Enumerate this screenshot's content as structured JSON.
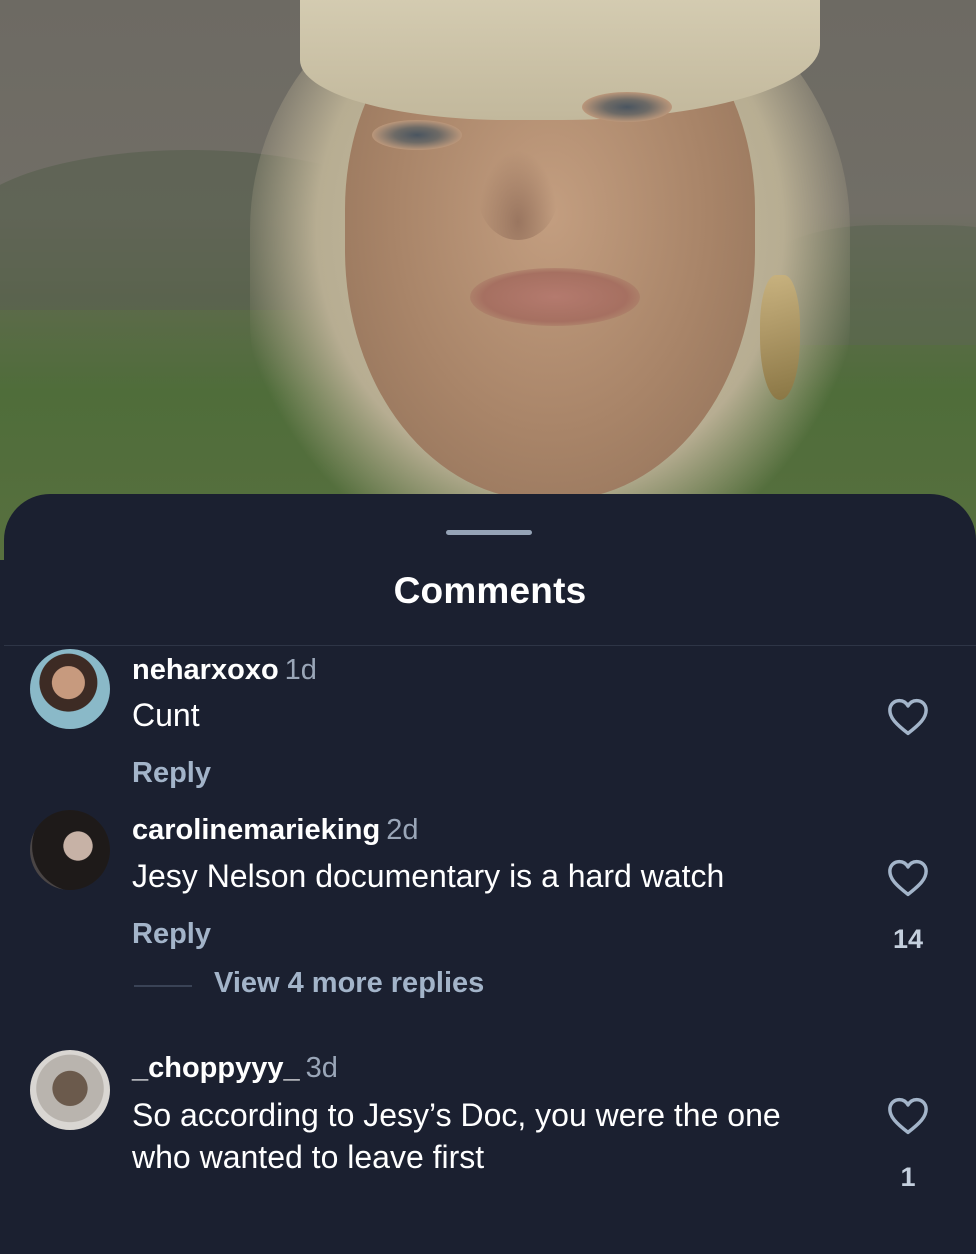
{
  "sheet": {
    "title": "Comments"
  },
  "comments": [
    {
      "username": "neharxoxo",
      "time": "1d",
      "text": "Cunt",
      "reply_label": "Reply",
      "likes": ""
    },
    {
      "username": "carolinemarieking",
      "time": "2d",
      "text": "Jesy Nelson documentary is a hard watch",
      "reply_label": "Reply",
      "likes": "14",
      "view_replies_label": "View 4 more replies"
    },
    {
      "username": "_choppyyy_",
      "time": "3d",
      "text": "So according to Jesy’s Doc, you were the one who wanted to leave first",
      "likes": "1"
    }
  ],
  "colors": {
    "sheet_background": "#1b2030",
    "username": "#ffffff",
    "timestamp": "#9aa6b8",
    "reply_link": "#a3b4c9",
    "heart_outline": "#a3b4c9",
    "like_count": "#c4cfdd"
  },
  "icons": {
    "like": "heart-outline-icon",
    "grabber": "drag-handle"
  }
}
